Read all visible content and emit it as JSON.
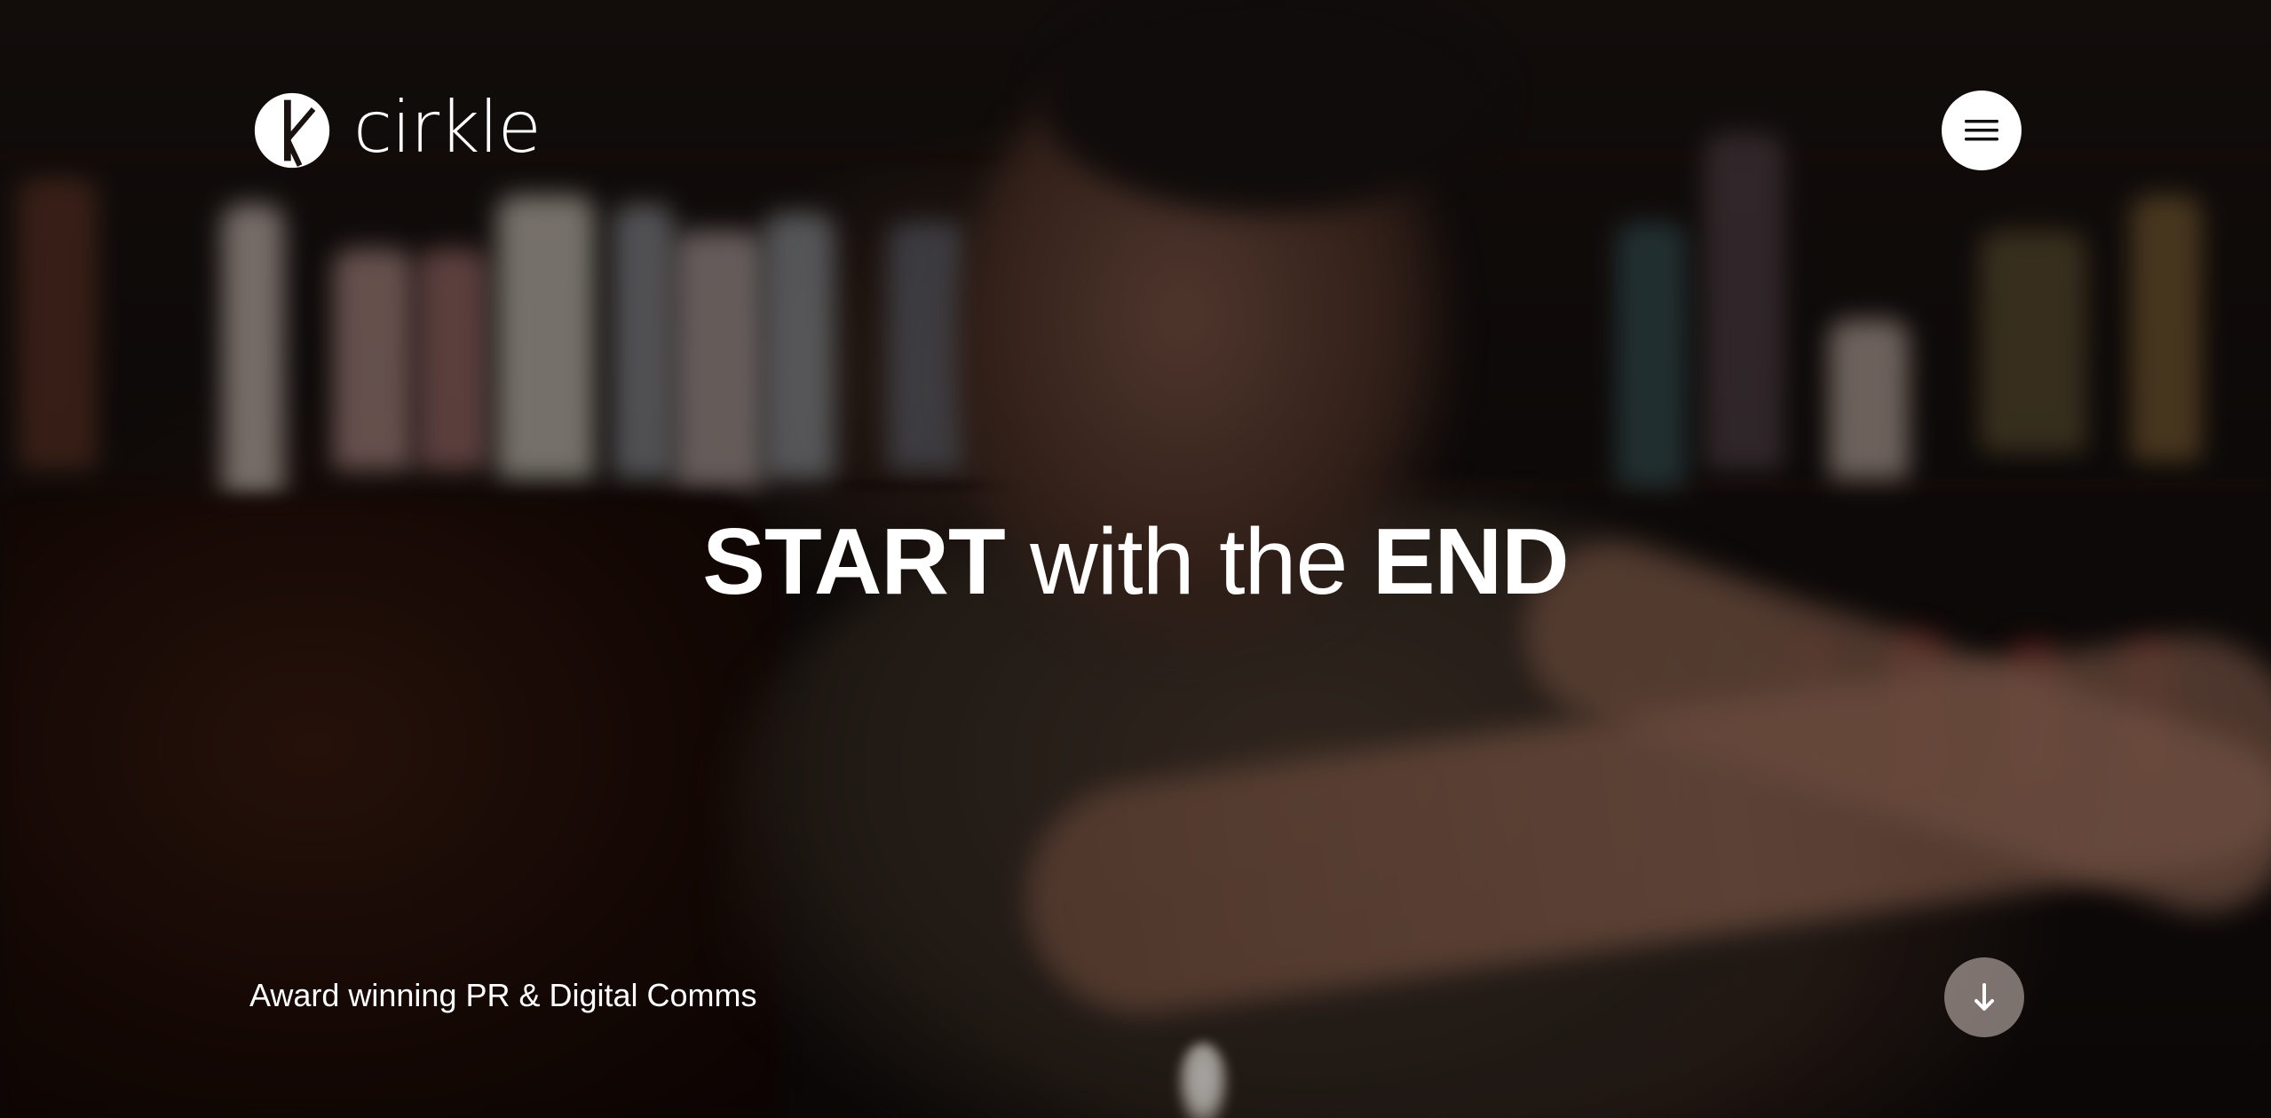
{
  "brand": {
    "name": "cirkle",
    "logo_icon": "cirkle-logo-mark",
    "primary_color": "#ffffff"
  },
  "header": {
    "menu_icon": "hamburger-menu-icon"
  },
  "hero": {
    "headline_part1": "START",
    "headline_part2": "with the",
    "headline_part3": "END",
    "tagline": "Award winning PR & Digital Comms",
    "scroll_icon": "arrow-down-icon",
    "background": "blurred video of bartender shaking a cocktail at a bar"
  }
}
